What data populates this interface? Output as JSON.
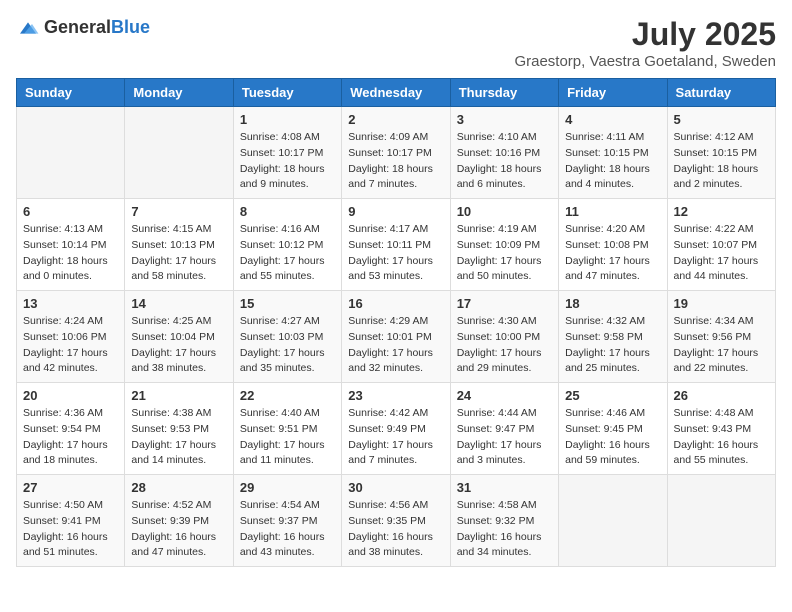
{
  "header": {
    "logo_general": "General",
    "logo_blue": "Blue",
    "month": "July 2025",
    "location": "Graestorp, Vaestra Goetaland, Sweden"
  },
  "weekdays": [
    "Sunday",
    "Monday",
    "Tuesday",
    "Wednesday",
    "Thursday",
    "Friday",
    "Saturday"
  ],
  "weeks": [
    [
      {
        "day": "",
        "info": ""
      },
      {
        "day": "",
        "info": ""
      },
      {
        "day": "1",
        "info": "Sunrise: 4:08 AM\nSunset: 10:17 PM\nDaylight: 18 hours and 9 minutes."
      },
      {
        "day": "2",
        "info": "Sunrise: 4:09 AM\nSunset: 10:17 PM\nDaylight: 18 hours and 7 minutes."
      },
      {
        "day": "3",
        "info": "Sunrise: 4:10 AM\nSunset: 10:16 PM\nDaylight: 18 hours and 6 minutes."
      },
      {
        "day": "4",
        "info": "Sunrise: 4:11 AM\nSunset: 10:15 PM\nDaylight: 18 hours and 4 minutes."
      },
      {
        "day": "5",
        "info": "Sunrise: 4:12 AM\nSunset: 10:15 PM\nDaylight: 18 hours and 2 minutes."
      }
    ],
    [
      {
        "day": "6",
        "info": "Sunrise: 4:13 AM\nSunset: 10:14 PM\nDaylight: 18 hours and 0 minutes."
      },
      {
        "day": "7",
        "info": "Sunrise: 4:15 AM\nSunset: 10:13 PM\nDaylight: 17 hours and 58 minutes."
      },
      {
        "day": "8",
        "info": "Sunrise: 4:16 AM\nSunset: 10:12 PM\nDaylight: 17 hours and 55 minutes."
      },
      {
        "day": "9",
        "info": "Sunrise: 4:17 AM\nSunset: 10:11 PM\nDaylight: 17 hours and 53 minutes."
      },
      {
        "day": "10",
        "info": "Sunrise: 4:19 AM\nSunset: 10:09 PM\nDaylight: 17 hours and 50 minutes."
      },
      {
        "day": "11",
        "info": "Sunrise: 4:20 AM\nSunset: 10:08 PM\nDaylight: 17 hours and 47 minutes."
      },
      {
        "day": "12",
        "info": "Sunrise: 4:22 AM\nSunset: 10:07 PM\nDaylight: 17 hours and 44 minutes."
      }
    ],
    [
      {
        "day": "13",
        "info": "Sunrise: 4:24 AM\nSunset: 10:06 PM\nDaylight: 17 hours and 42 minutes."
      },
      {
        "day": "14",
        "info": "Sunrise: 4:25 AM\nSunset: 10:04 PM\nDaylight: 17 hours and 38 minutes."
      },
      {
        "day": "15",
        "info": "Sunrise: 4:27 AM\nSunset: 10:03 PM\nDaylight: 17 hours and 35 minutes."
      },
      {
        "day": "16",
        "info": "Sunrise: 4:29 AM\nSunset: 10:01 PM\nDaylight: 17 hours and 32 minutes."
      },
      {
        "day": "17",
        "info": "Sunrise: 4:30 AM\nSunset: 10:00 PM\nDaylight: 17 hours and 29 minutes."
      },
      {
        "day": "18",
        "info": "Sunrise: 4:32 AM\nSunset: 9:58 PM\nDaylight: 17 hours and 25 minutes."
      },
      {
        "day": "19",
        "info": "Sunrise: 4:34 AM\nSunset: 9:56 PM\nDaylight: 17 hours and 22 minutes."
      }
    ],
    [
      {
        "day": "20",
        "info": "Sunrise: 4:36 AM\nSunset: 9:54 PM\nDaylight: 17 hours and 18 minutes."
      },
      {
        "day": "21",
        "info": "Sunrise: 4:38 AM\nSunset: 9:53 PM\nDaylight: 17 hours and 14 minutes."
      },
      {
        "day": "22",
        "info": "Sunrise: 4:40 AM\nSunset: 9:51 PM\nDaylight: 17 hours and 11 minutes."
      },
      {
        "day": "23",
        "info": "Sunrise: 4:42 AM\nSunset: 9:49 PM\nDaylight: 17 hours and 7 minutes."
      },
      {
        "day": "24",
        "info": "Sunrise: 4:44 AM\nSunset: 9:47 PM\nDaylight: 17 hours and 3 minutes."
      },
      {
        "day": "25",
        "info": "Sunrise: 4:46 AM\nSunset: 9:45 PM\nDaylight: 16 hours and 59 minutes."
      },
      {
        "day": "26",
        "info": "Sunrise: 4:48 AM\nSunset: 9:43 PM\nDaylight: 16 hours and 55 minutes."
      }
    ],
    [
      {
        "day": "27",
        "info": "Sunrise: 4:50 AM\nSunset: 9:41 PM\nDaylight: 16 hours and 51 minutes."
      },
      {
        "day": "28",
        "info": "Sunrise: 4:52 AM\nSunset: 9:39 PM\nDaylight: 16 hours and 47 minutes."
      },
      {
        "day": "29",
        "info": "Sunrise: 4:54 AM\nSunset: 9:37 PM\nDaylight: 16 hours and 43 minutes."
      },
      {
        "day": "30",
        "info": "Sunrise: 4:56 AM\nSunset: 9:35 PM\nDaylight: 16 hours and 38 minutes."
      },
      {
        "day": "31",
        "info": "Sunrise: 4:58 AM\nSunset: 9:32 PM\nDaylight: 16 hours and 34 minutes."
      },
      {
        "day": "",
        "info": ""
      },
      {
        "day": "",
        "info": ""
      }
    ]
  ]
}
